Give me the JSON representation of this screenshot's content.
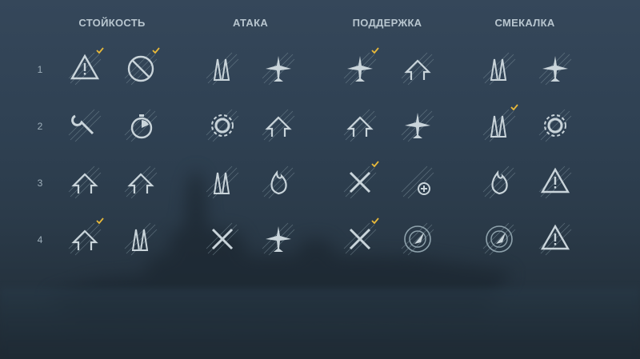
{
  "categories": [
    "СТОЙКОСТЬ",
    "АТАКА",
    "ПОДДЕРЖКА",
    "СМЕКАЛКА"
  ],
  "tiers": [
    "1",
    "2",
    "3",
    "4"
  ],
  "accent_color": "#e8b93a",
  "skills": [
    {
      "name": "priority-target-icon",
      "col": 0,
      "row": 0,
      "slot": 0,
      "selected": true
    },
    {
      "name": "incoming-fire-alert-icon",
      "col": 0,
      "row": 0,
      "slot": 1,
      "selected": true
    },
    {
      "name": "emergency-repair-specialist-icon",
      "col": 0,
      "row": 1,
      "slot": 0,
      "selected": false
    },
    {
      "name": "fill-the-tubes-icon",
      "col": 0,
      "row": 1,
      "slot": 1,
      "selected": false
    },
    {
      "name": "survivability-expert-icon",
      "col": 0,
      "row": 2,
      "slot": 0,
      "selected": false
    },
    {
      "name": "main-battery-expert-icon",
      "col": 0,
      "row": 2,
      "slot": 1,
      "selected": false
    },
    {
      "name": "superintendent-icon",
      "col": 0,
      "row": 3,
      "slot": 0,
      "selected": true
    },
    {
      "name": "fire-prevention-icon",
      "col": 0,
      "row": 3,
      "slot": 1,
      "selected": false
    },
    {
      "name": "gun-feeder-icon",
      "col": 1,
      "row": 0,
      "slot": 0,
      "selected": false
    },
    {
      "name": "aircraft-reload-icon",
      "col": 1,
      "row": 0,
      "slot": 1,
      "selected": false
    },
    {
      "name": "grease-the-gears-icon",
      "col": 1,
      "row": 1,
      "slot": 0,
      "selected": false
    },
    {
      "name": "torpedo-acceleration-icon",
      "col": 1,
      "row": 1,
      "slot": 1,
      "selected": false
    },
    {
      "name": "demolition-expert-icon",
      "col": 1,
      "row": 2,
      "slot": 0,
      "selected": false
    },
    {
      "name": "aa-guns-fire-icon",
      "col": 1,
      "row": 2,
      "slot": 1,
      "selected": false
    },
    {
      "name": "manual-secondary-icon",
      "col": 1,
      "row": 3,
      "slot": 0,
      "selected": false
    },
    {
      "name": "air-supremacy-icon",
      "col": 1,
      "row": 3,
      "slot": 1,
      "selected": false
    },
    {
      "name": "fighter-target-icon",
      "col": 2,
      "row": 0,
      "slot": 0,
      "selected": true
    },
    {
      "name": "aircraft-armor-icon",
      "col": 2,
      "row": 0,
      "slot": 1,
      "selected": false
    },
    {
      "name": "smoke-screen-expert-icon",
      "col": 2,
      "row": 1,
      "slot": 0,
      "selected": false
    },
    {
      "name": "aircraft-speed-icon",
      "col": 2,
      "row": 1,
      "slot": 1,
      "selected": false
    },
    {
      "name": "basic-aa-icon",
      "col": 2,
      "row": 2,
      "slot": 0,
      "selected": true
    },
    {
      "name": "aa-repair-icon",
      "col": 2,
      "row": 2,
      "slot": 1,
      "selected": false
    },
    {
      "name": "advanced-aa-icon",
      "col": 2,
      "row": 3,
      "slot": 0,
      "selected": true
    },
    {
      "name": "radio-location-icon",
      "col": 2,
      "row": 3,
      "slot": 1,
      "selected": false
    },
    {
      "name": "torpedo-alert-icon",
      "col": 3,
      "row": 0,
      "slot": 0,
      "selected": false
    },
    {
      "name": "aircraft-heal-icon",
      "col": 3,
      "row": 0,
      "slot": 1,
      "selected": false
    },
    {
      "name": "torpedo-expert-icon",
      "col": 3,
      "row": 1,
      "slot": 0,
      "selected": true
    },
    {
      "name": "consumables-specialist-icon",
      "col": 3,
      "row": 1,
      "slot": 1,
      "selected": false
    },
    {
      "name": "torpedo-fire-icon",
      "col": 3,
      "row": 2,
      "slot": 0,
      "selected": false
    },
    {
      "name": "last-stand-icon",
      "col": 3,
      "row": 2,
      "slot": 1,
      "selected": false
    },
    {
      "name": "concealment-radar-icon",
      "col": 3,
      "row": 3,
      "slot": 0,
      "selected": false
    },
    {
      "name": "warning-down-icon",
      "col": 3,
      "row": 3,
      "slot": 1,
      "selected": false
    }
  ]
}
